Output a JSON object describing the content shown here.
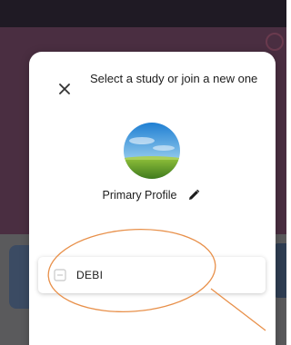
{
  "dialog": {
    "title": "Select a study or join a new one",
    "close_icon": "close-icon"
  },
  "profile": {
    "name": "Primary Profile",
    "avatar_icon": "landscape-avatar",
    "edit_icon": "pencil-icon"
  },
  "studies": [
    {
      "label": "DEBI",
      "icon": "study-icon"
    }
  ],
  "colors": {
    "backdrop": "#4a2e41",
    "sheet": "#ffffff",
    "annotation": "#e8904a"
  }
}
